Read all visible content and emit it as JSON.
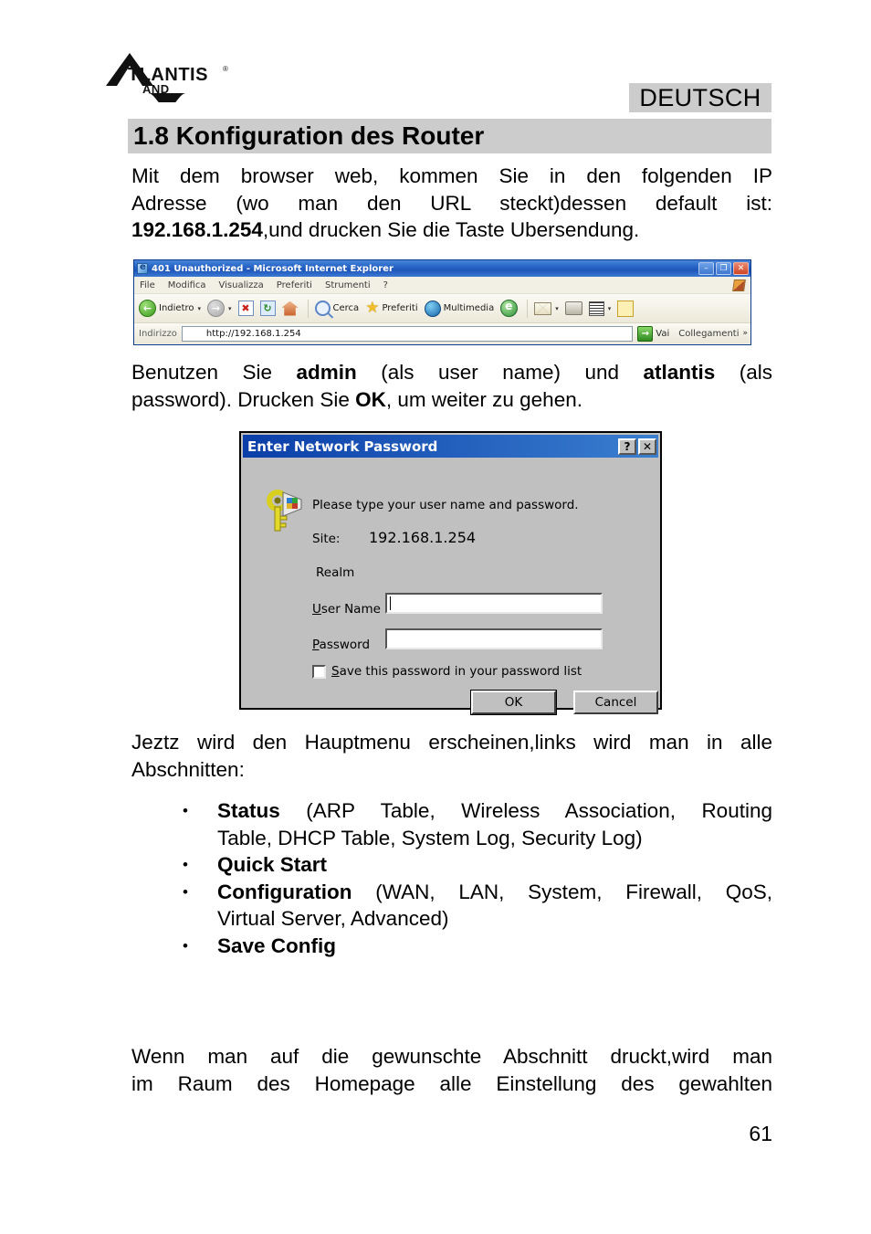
{
  "document": {
    "language_band": "DEUTSCH",
    "section_title": "1.8 Konfiguration des Router",
    "page_number": "61",
    "logo_alt": "ATLANTIS LAND"
  },
  "paragraphs": {
    "intro_line1": "Mit dem browser web, kommen Sie in den folgenden IP",
    "intro_line2": "Adresse (wo man den URL steckt)dessen default ist:",
    "intro_ip": "192.168.1.254",
    "intro_line3_rest": ",und drucken Sie die Taste Ubersendung.",
    "login_pre": "Benutzen Sie ",
    "login_user": "admin",
    "login_mid1": " (als user name) und ",
    "login_pass": "atlantis",
    "login_mid2": " (als",
    "login_line2_pre": "password). Drucken Sie ",
    "login_ok": "OK",
    "login_line2_post": ", um weiter zu gehen.",
    "menu_line1": "Jeztz wird den Hauptmenu erscheinen,links wird man in alle",
    "menu_line2": "Abschnitten:",
    "closing_line1": "Wenn man auf die gewunschte Abschnitt druckt,wird man",
    "closing_line2": "im Raum des Homepage alle Einstellung des gewahlten"
  },
  "bullets": [
    {
      "marker": "•",
      "bold": "Status",
      "rest": " (ARP Table, Wireless Association, Routing",
      "line2": "Table, DHCP Table, System Log, Security Log)"
    },
    {
      "marker": "•",
      "bold": "Quick Start",
      "rest": "",
      "line2": ""
    },
    {
      "marker": "•",
      "bold": "Configuration",
      "rest": " (WAN, LAN, System, Firewall, QoS,",
      "line2": "Virtual Server, Advanced)"
    },
    {
      "marker": "•",
      "bold": "Save Config",
      "rest": "",
      "line2": ""
    }
  ],
  "browser_window": {
    "title": "401 Unauthorized - Microsoft Internet Explorer",
    "window_buttons": {
      "minimize": "–",
      "restore": "❐",
      "close": "✕"
    },
    "menu_items": [
      "File",
      "Modifica",
      "Visualizza",
      "Preferiti",
      "Strumenti",
      "?"
    ],
    "toolbar": {
      "back_label": "Indietro",
      "forward_label": "",
      "stop_glyph": "✖",
      "refresh_glyph": "↻",
      "home_label": "",
      "search_label": "Cerca",
      "favorites_label": "Preferiti",
      "media_label": "Multimedia",
      "history_label": "",
      "mail_label": "",
      "print_label": "",
      "edit_label": "",
      "discuss_label": "",
      "dropdown_glyph": "▾"
    },
    "address_bar": {
      "label": "Indirizzo",
      "value": "http://192.168.1.254",
      "dropdown_glyph": "▾",
      "go_glyph": "→",
      "go_label": "Vai",
      "links_label": "Collegamenti",
      "overflow_glyph": "»"
    }
  },
  "password_dialog": {
    "title": "Enter Network Password",
    "help_glyph": "?",
    "close_glyph": "✕",
    "prompt": "Please type your user name and password.",
    "site_label": "Site:",
    "site_value": "192.168.1.254",
    "realm_label": "Realm",
    "user_label_underlined": "U",
    "user_label_rest": "ser Name",
    "user_value": "",
    "password_label_underlined": "P",
    "password_label_rest": "assword",
    "password_value": "",
    "save_checkbox_underlined": "S",
    "save_checkbox_rest": "ave this password in your password list",
    "save_checked": false,
    "ok_label": "OK",
    "cancel_label": "Cancel"
  },
  "colors": {
    "band_gray": "#cccccc",
    "dialog_gray": "#c0c0c0",
    "titlebar_blue": "#0b3ea8",
    "ie_titlebar_blue": "#2a68c8"
  }
}
